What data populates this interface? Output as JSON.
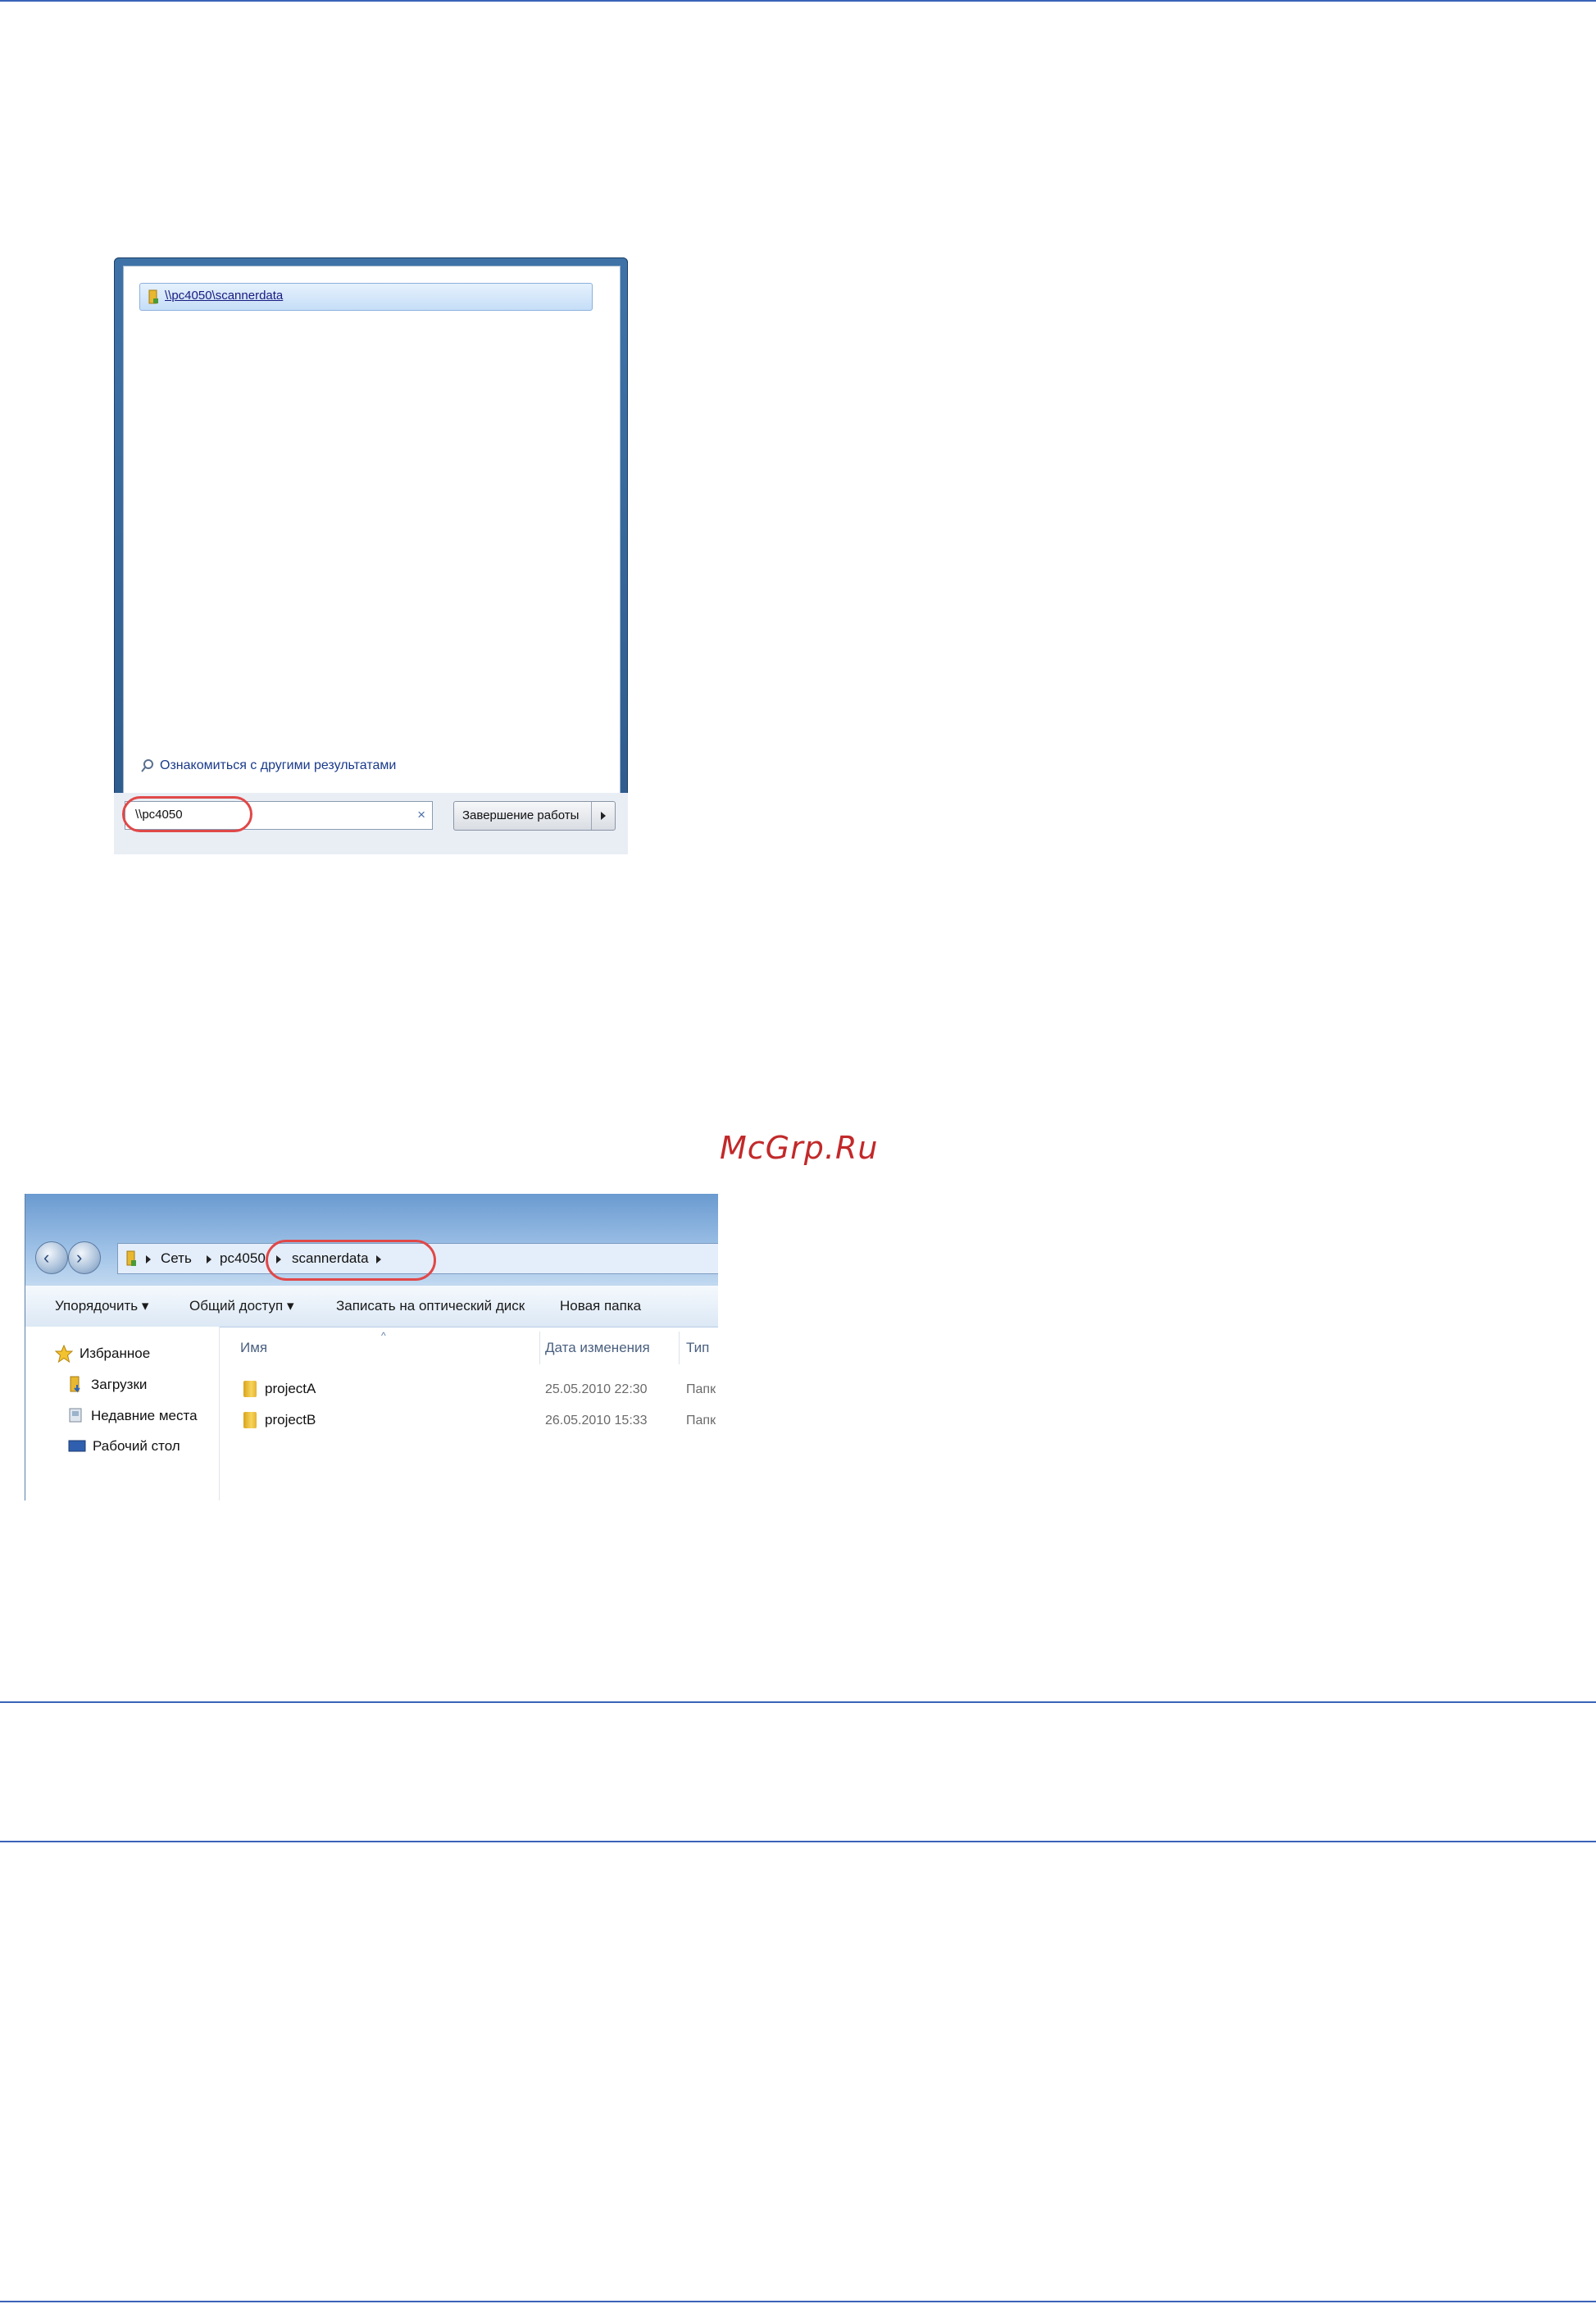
{
  "start_menu": {
    "result_item": "\\\\pc4050\\scannerdata",
    "more_results": "Ознакомиться с другими результатами",
    "search_value": "\\\\pc4050",
    "shutdown_label": "Завершение работы"
  },
  "watermark": "McGrp.Ru",
  "explorer": {
    "breadcrumbs": [
      "Сеть",
      "pc4050",
      "scannerdata"
    ],
    "toolbar": [
      "Упорядочить ▾",
      "Общий доступ ▾",
      "Записать на оптический диск",
      "Новая папка"
    ],
    "sidebar": [
      "Избранное",
      "Загрузки",
      "Недавние места",
      "Рабочий стол"
    ],
    "columns": [
      "Имя",
      "Дата изменения",
      "Тип"
    ],
    "rows": [
      {
        "name": "projectA",
        "date": "25.05.2010 22:30",
        "type": "Папк"
      },
      {
        "name": "projectB",
        "date": "26.05.2010 15:33",
        "type": "Папк"
      }
    ]
  },
  "colors": {
    "rule": "#3a63b8",
    "highlight": "#e04848",
    "watermark": "#c2292a"
  }
}
